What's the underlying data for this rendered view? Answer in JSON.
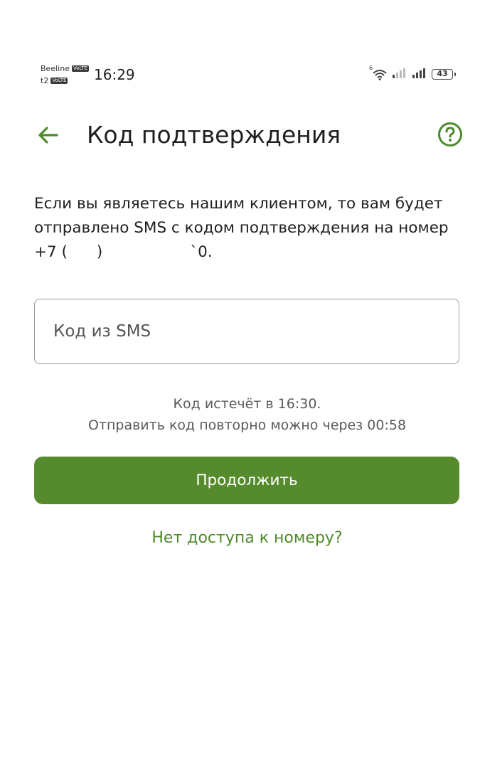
{
  "status_bar": {
    "carrier_1": "Beeline",
    "carrier_2": "t2",
    "volte_badge": "VoLTE",
    "time": "16:29",
    "wifi_badge": "6",
    "battery_level": "43",
    "icons": [
      "wifi-icon",
      "signal-icon",
      "signal-icon",
      "battery-icon"
    ]
  },
  "header": {
    "title": "Код подтверждения",
    "back_icon": "arrow-left-icon",
    "help_icon": "question-circle-icon"
  },
  "description": {
    "line1": "Если вы являетесь нашим клиентом, то вам будет",
    "line2": "отправлено SMS с кодом подтверждения на номер",
    "phone": "+7 (      )                  `0."
  },
  "sms_input": {
    "placeholder": "Код из SMS",
    "value": ""
  },
  "timer": {
    "expires": "Код истечёт в 16:30.",
    "resend": "Отправить код повторно можно через 00:58"
  },
  "continue_button": {
    "label": "Продолжить"
  },
  "no_access_link": {
    "label": "Нет доступа к номеру?"
  },
  "colors": {
    "accent": "#568b2d",
    "link": "#4f8a2a",
    "icon": "#4c8a2b"
  }
}
